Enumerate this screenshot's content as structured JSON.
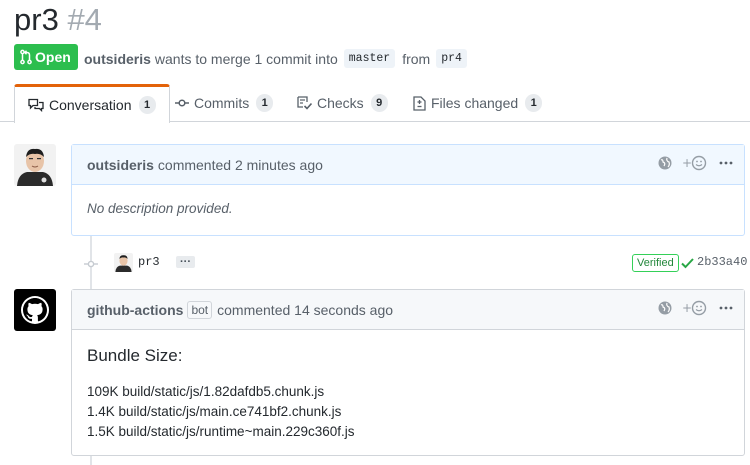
{
  "pr": {
    "title": "pr3",
    "number": "#4",
    "state": "Open",
    "author": "outsideris",
    "merge_text": "wants to merge 1 commit into",
    "base_branch": "master",
    "from_text": "from",
    "head_branch": "pr4"
  },
  "tabs": [
    {
      "label": "Conversation",
      "count": "1",
      "icon": "comment-discussion-icon"
    },
    {
      "label": "Commits",
      "count": "1",
      "icon": "git-commit-icon"
    },
    {
      "label": "Checks",
      "count": "9",
      "icon": "checklist-icon"
    },
    {
      "label": "Files changed",
      "count": "1",
      "icon": "file-diff-icon"
    }
  ],
  "comments": [
    {
      "author": "outsideris",
      "action": "commented 2 minutes ago",
      "body": "No description provided."
    },
    {
      "author": "github-actions",
      "badge": "bot",
      "action": "commented 14 seconds ago",
      "heading": "Bundle Size:",
      "lines": [
        "109K build/static/js/1.82dafdb5.chunk.js",
        "1.4K build/static/js/main.ce741bf2.chunk.js",
        "1.5K build/static/js/runtime~main.229c360f.js"
      ]
    }
  ],
  "commit": {
    "message": "pr3",
    "ellipsis": "···",
    "verified": "Verified",
    "sha": "2b33a40"
  },
  "colors": {
    "open_green": "#2cbe4e",
    "tab_accent": "#e36209",
    "comment_header": "#f1f8ff",
    "verified_green": "#22863a"
  }
}
